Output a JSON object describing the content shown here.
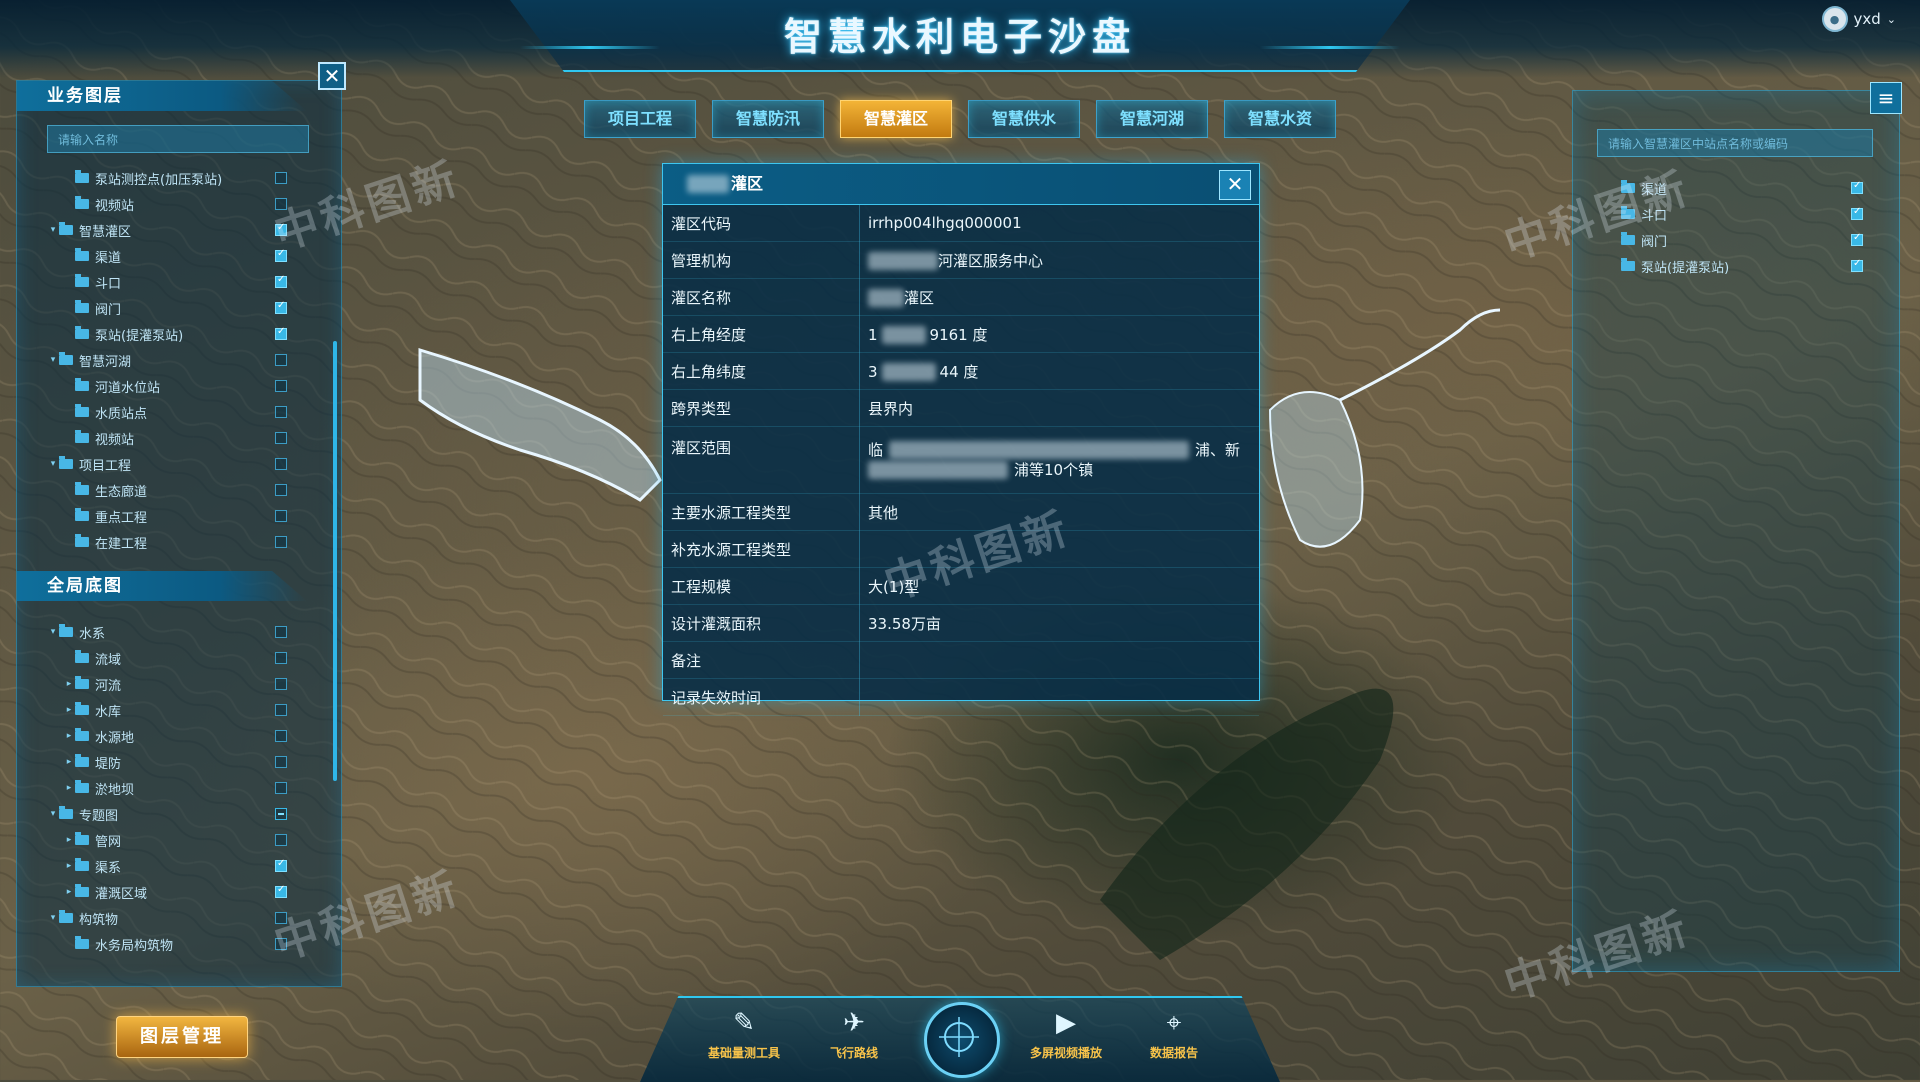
{
  "app": {
    "title": "智慧水利电子沙盘"
  },
  "user": {
    "name": "yxd"
  },
  "left_panel": {
    "business_layers": {
      "title": "业务图层",
      "search_placeholder": "请输入名称",
      "items": [
        {
          "label": "泵站测控点(加压泵站)",
          "level": 2,
          "checked": "off"
        },
        {
          "label": "视频站",
          "level": 2,
          "checked": "off"
        },
        {
          "label": "智慧灌区",
          "level": 1,
          "expanded": true,
          "checked": "on"
        },
        {
          "label": "渠道",
          "level": 2,
          "checked": "on"
        },
        {
          "label": "斗口",
          "level": 2,
          "checked": "on"
        },
        {
          "label": "阀门",
          "level": 2,
          "checked": "on"
        },
        {
          "label": "泵站(提灌泵站)",
          "level": 2,
          "checked": "on"
        },
        {
          "label": "智慧河湖",
          "level": 1,
          "expanded": true,
          "checked": "off"
        },
        {
          "label": "河道水位站",
          "level": 2,
          "checked": "off"
        },
        {
          "label": "水质站点",
          "level": 2,
          "checked": "off"
        },
        {
          "label": "视频站",
          "level": 2,
          "checked": "off"
        },
        {
          "label": "项目工程",
          "level": 1,
          "expanded": true,
          "checked": "off"
        },
        {
          "label": "生态廊道",
          "level": 2,
          "checked": "off"
        },
        {
          "label": "重点工程",
          "level": 2,
          "checked": "off"
        },
        {
          "label": "在建工程",
          "level": 2,
          "checked": "off"
        }
      ]
    },
    "base_maps": {
      "title": "全局底图",
      "items": [
        {
          "label": "水系",
          "level": 1,
          "expanded": true,
          "checked": "off"
        },
        {
          "label": "流域",
          "level": 2,
          "checked": "off"
        },
        {
          "label": "河流",
          "level": 2,
          "collapsed": true,
          "checked": "off"
        },
        {
          "label": "水库",
          "level": 2,
          "collapsed": true,
          "checked": "off"
        },
        {
          "label": "水源地",
          "level": 2,
          "collapsed": true,
          "checked": "off"
        },
        {
          "label": "堤防",
          "level": 2,
          "collapsed": true,
          "checked": "off"
        },
        {
          "label": "淤地坝",
          "level": 2,
          "collapsed": true,
          "checked": "off"
        },
        {
          "label": "专题图",
          "level": 1,
          "expanded": true,
          "checked": "partial"
        },
        {
          "label": "管网",
          "level": 2,
          "collapsed": true,
          "checked": "off"
        },
        {
          "label": "渠系",
          "level": 2,
          "collapsed": true,
          "checked": "on"
        },
        {
          "label": "灌溉区域",
          "level": 2,
          "collapsed": true,
          "checked": "on"
        },
        {
          "label": "构筑物",
          "level": 1,
          "expanded": true,
          "checked": "off"
        },
        {
          "label": "水务局构筑物",
          "level": 2,
          "checked": "off"
        }
      ]
    },
    "layer_manage_button": "图层管理"
  },
  "tabs": [
    {
      "label": "项目工程",
      "active": false
    },
    {
      "label": "智慧防汛",
      "active": false
    },
    {
      "label": "智慧灌区",
      "active": true
    },
    {
      "label": "智慧供水",
      "active": false
    },
    {
      "label": "智慧河湖",
      "active": false
    },
    {
      "label": "智慧水资",
      "active": false
    }
  ],
  "popup": {
    "title": "灌区",
    "rows": [
      {
        "key": "灌区代码",
        "value": "irrhp004lhgq000001"
      },
      {
        "key": "管理机构",
        "value": "河灌区服务中心"
      },
      {
        "key": "灌区名称",
        "value": "灌区"
      },
      {
        "key": "右上角经度",
        "value_prefix": "1",
        "value": "9161 度"
      },
      {
        "key": "右上角纬度",
        "value_prefix": "3",
        "value": "44 度"
      },
      {
        "key": "跨界类型",
        "value": "县界内"
      },
      {
        "key": "灌区范围",
        "value_prefix": "临",
        "value_suffix": "浦、新",
        "value_line2": "浦等10个镇"
      },
      {
        "key": "主要水源工程类型",
        "value": "其他"
      },
      {
        "key": "补充水源工程类型",
        "value": ""
      },
      {
        "key": "工程规模",
        "value": "大(1)型"
      },
      {
        "key": "设计灌溉面积",
        "value": "33.58万亩"
      },
      {
        "key": "备注",
        "value": ""
      },
      {
        "key": "记录失效时间",
        "value": ""
      }
    ]
  },
  "right_panel": {
    "search_placeholder": "请输入智慧灌区中站点名称或编码",
    "items": [
      {
        "label": "渠道",
        "checked": "on"
      },
      {
        "label": "斗口",
        "checked": "on"
      },
      {
        "label": "阀门",
        "checked": "on"
      },
      {
        "label": "泵站(提灌泵站)",
        "checked": "on"
      }
    ]
  },
  "bottom_tools": [
    {
      "label": "基础量测工具",
      "icon": "ruler-pencil-icon"
    },
    {
      "label": "飞行路线",
      "icon": "airplane-icon"
    },
    {
      "label": "多屏视频播放",
      "icon": "video-play-icon"
    },
    {
      "label": "数据报告",
      "icon": "map-pin-icon"
    }
  ],
  "watermark": "中科图新",
  "colors": {
    "accent": "#2fc7f0",
    "active_tab": "#e8a22c",
    "panel_bg": "#0a3048"
  }
}
